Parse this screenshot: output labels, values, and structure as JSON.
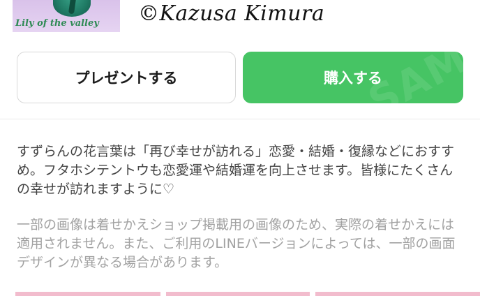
{
  "header": {
    "thumbnail_caption": "Lily of the valley",
    "copyright": "©Kazusa Kimura"
  },
  "actions": {
    "gift_label": "プレゼントする",
    "buy_label": "購入する",
    "buy_watermark": "SAM"
  },
  "description": "すずらんの花言葉は「再び幸せが訪れる」恋愛・結婚・復縁などにおすすめ。フタホシテントウも恋愛運や結婚運を向上させます。皆様にたくさんの幸せが訪れますように♡",
  "disclaimer": "一部の画像は着せかえショップ掲載用の画像のため、実際の着せかえには適用されません。また、ご利用のLINEバージョンによっては、一部の画面デザインが異なる場合があります。",
  "colors": {
    "buy_button": "#46c464",
    "preview_strip": "#f2bccd"
  }
}
